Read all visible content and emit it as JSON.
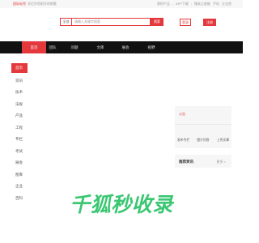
{
  "topbar": {
    "brand": "国际标兜",
    "slogan": "学迟并而昭开的期套",
    "links": [
      "我的产品",
      "APP下载",
      "微软之前能",
      "手机",
      "企业首"
    ]
  },
  "search": {
    "category": "全部",
    "placeholder": "请输入关键字搜索",
    "button_label": "搜索"
  },
  "auth": {
    "login_label": "登录",
    "register_label": "注册"
  },
  "nav": {
    "items": [
      "首页",
      "团队",
      "问题",
      "文库",
      "展会",
      "视野"
    ]
  },
  "sidebar": {
    "items": [
      "首页",
      "资讯",
      "技术",
      "法规",
      "产品",
      "工程",
      "专栏",
      "考试",
      "展会",
      "图库",
      "企业",
      "百科"
    ]
  },
  "login_panel": {
    "hint": "公告",
    "actions": [
      "发布专栏",
      "图片问答",
      "上传文章"
    ]
  },
  "recommend": {
    "title": "推荐资讯",
    "more": "更多 >"
  },
  "watermark": {
    "text": "千狐秒收录"
  },
  "colors": {
    "accent": "#e4393c",
    "nav_bg": "#111111",
    "watermark": "#30c46b"
  }
}
